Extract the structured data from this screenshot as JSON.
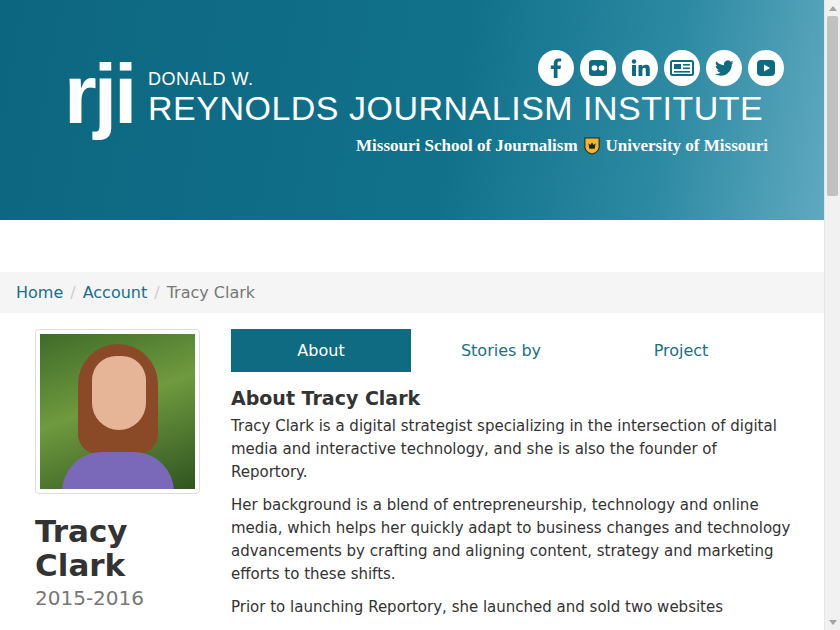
{
  "header": {
    "logo_mark": "rji",
    "name_small": "DONALD W.",
    "name": "REYNOLDS JOURNALISM INSTITUTE",
    "school": "Missouri School of Journalism",
    "university": "University of Missouri"
  },
  "breadcrumb": {
    "separator": "/",
    "items": [
      {
        "label": "Home",
        "current": false
      },
      {
        "label": "Account",
        "current": false
      },
      {
        "label": "Tracy Clark",
        "current": true
      }
    ]
  },
  "profile": {
    "name": "Tracy Clark",
    "years": "2015-2016"
  },
  "tabs": [
    {
      "label": "About",
      "selected": true
    },
    {
      "label": "Stories by",
      "selected": false
    },
    {
      "label": "Project",
      "selected": false
    }
  ],
  "about": {
    "heading": "About Tracy Clark",
    "paragraphs": [
      "Tracy Clark is a digital strategist specializing in the intersection of digital media and interactive technology, and she is also the founder of Reportory.",
      "Her background is a blend of entrepreneurship, technology and online media, which helps her quickly adapt to business changes and technology advancements by crafting and aligning content, strategy and marketing efforts to these shifts.",
      "Prior to launching Reportory, she launched and sold two websites"
    ]
  }
}
